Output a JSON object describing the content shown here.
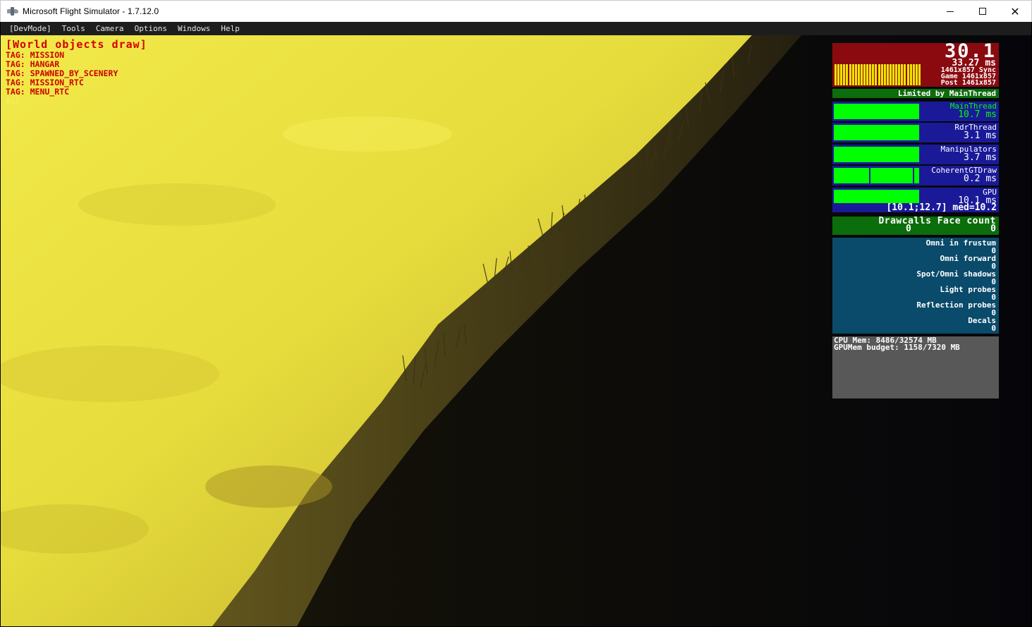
{
  "window": {
    "title": "Microsoft Flight Simulator - 1.7.12.0",
    "minimize": "",
    "maximize": "",
    "close": "✕"
  },
  "menubar": {
    "items": [
      "[DevMode]",
      "Tools",
      "Camera",
      "Options",
      "Windows",
      "Help"
    ]
  },
  "overlay": {
    "title": "[World objects draw]",
    "tags": [
      "TAG: MISSION",
      "TAG: HANGAR",
      "TAG: SPAWNED_BY_SCENERY",
      "TAG: MISSION_RTC",
      "TAG: MENU_RTC"
    ],
    "all": "All"
  },
  "stats": {
    "fps": "30.1",
    "frame_ms": "33.27 ms",
    "sync": "1461x857 Sync",
    "game": "Game 1461x857",
    "post": "Post 1461x857",
    "limited": "Limited by MainThread",
    "threads": [
      {
        "name": "MainThread",
        "value": "10.7 ms",
        "highlight": true,
        "fill": 0.52
      },
      {
        "name": "RdrThread",
        "value": "3.1 ms",
        "highlight": false,
        "fill": 0.52
      },
      {
        "name": "Manipulators",
        "value": "3.7 ms",
        "highlight": false,
        "fill": 0.52
      },
      {
        "name": "CoherentGTDraw",
        "value": "0.2 ms",
        "highlight": false,
        "fill": 0.52
      },
      {
        "name": "GPU",
        "value": "10.1 ms",
        "highlight": false,
        "fill": 0.52
      }
    ],
    "gpu_range": "[10.1;12.7] med=10.2",
    "drawcalls": {
      "header": "Drawcalls Face count",
      "drawcalls": "0",
      "face_count": "0"
    },
    "lights": [
      {
        "label": "Omni in frustum",
        "value": "0"
      },
      {
        "label": "Omni forward",
        "value": "0"
      },
      {
        "label": "Spot/Omni shadows",
        "value": "0"
      },
      {
        "label": "Light probes",
        "value": "0"
      },
      {
        "label": "Reflection probes",
        "value": "0"
      },
      {
        "label": "Decals",
        "value": "0"
      }
    ],
    "cpu_mem": "CPU Mem: 8486/32574 MB",
    "gpu_mem": "GPUMem budget: 1158/7320 MB"
  },
  "colors": {
    "ground_lit": "#e6dc3c",
    "ground_shadow": "#0b0a0e",
    "fps_panel": "#8a0a10",
    "bar_green": "#00ff00",
    "thread_bg": "#1a1a99"
  }
}
